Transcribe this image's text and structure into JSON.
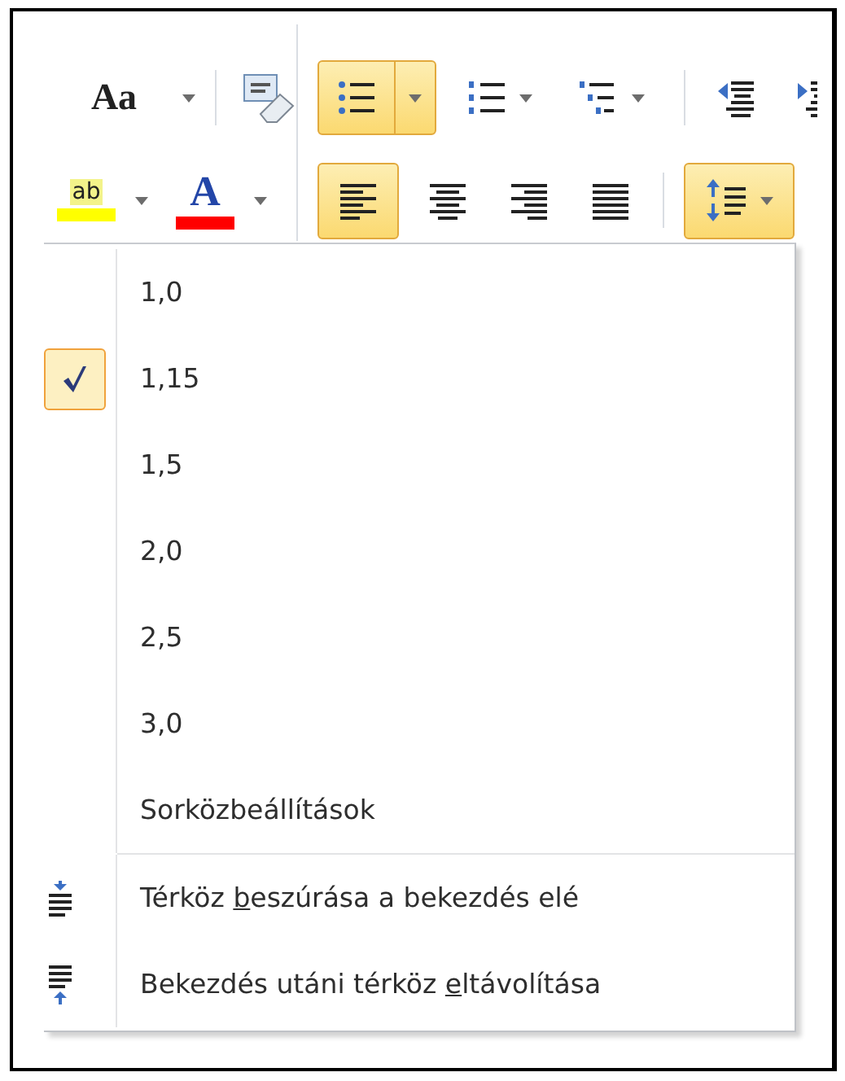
{
  "ribbon": {
    "font_row1": [
      {
        "kind": "styles",
        "label": "Aa"
      },
      {
        "kind": "clear-formatting"
      }
    ],
    "font_row2": [
      {
        "kind": "highlight",
        "label": "ab",
        "color": "#ffff00"
      },
      {
        "kind": "font-color",
        "label": "A",
        "color": "#ff0000"
      }
    ],
    "para_row1": [
      {
        "kind": "bullets",
        "selected": true
      },
      {
        "kind": "numbering",
        "selected": false
      },
      {
        "kind": "multilevel",
        "selected": false
      },
      {
        "kind": "decrease-indent",
        "selected": false
      },
      {
        "kind": "increase-indent",
        "selected": false
      }
    ],
    "para_row2": [
      {
        "kind": "align-left",
        "selected": true
      },
      {
        "kind": "center",
        "selected": false
      },
      {
        "kind": "align-right",
        "selected": false
      },
      {
        "kind": "justify",
        "selected": false
      },
      {
        "kind": "line-spacing",
        "selected": true
      }
    ]
  },
  "line_spacing_menu": {
    "options": [
      {
        "label": "1,0",
        "selected": false
      },
      {
        "label": "1,15",
        "selected": true
      },
      {
        "label": "1,5",
        "selected": false
      },
      {
        "label": "2,0",
        "selected": false
      },
      {
        "label": "2,5",
        "selected": false
      },
      {
        "label": "3,0",
        "selected": false
      }
    ],
    "settings": "Sorközbeállítások",
    "actions": [
      {
        "kind": "add-space-before",
        "parts": [
          "Térköz ",
          "b",
          "eszúrása a bekezdés elé"
        ]
      },
      {
        "kind": "remove-space-after",
        "parts": [
          "Bekezdés utáni térköz ",
          "e",
          "ltávolítása"
        ]
      }
    ]
  }
}
